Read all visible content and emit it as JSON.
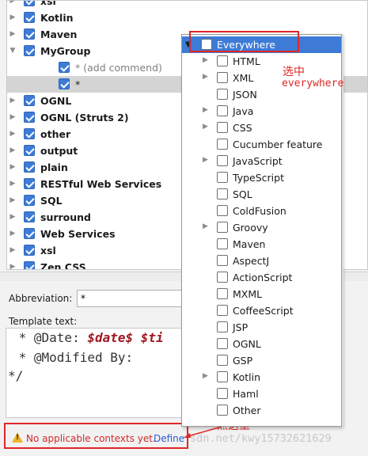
{
  "tree": {
    "items": [
      {
        "label": "xsl",
        "type": "group"
      },
      {
        "label": "Kotlin",
        "type": "group"
      },
      {
        "label": "Maven",
        "type": "group"
      },
      {
        "label": "MyGroup",
        "type": "group",
        "expanded": true
      },
      {
        "label": "* (add commend)",
        "type": "child"
      },
      {
        "label": "*",
        "type": "child",
        "selected": true
      },
      {
        "label": "OGNL",
        "type": "group"
      },
      {
        "label": "OGNL (Struts 2)",
        "type": "group"
      },
      {
        "label": "other",
        "type": "group"
      },
      {
        "label": "output",
        "type": "group"
      },
      {
        "label": "plain",
        "type": "group"
      },
      {
        "label": "RESTful Web Services",
        "type": "group"
      },
      {
        "label": "SQL",
        "type": "group"
      },
      {
        "label": "surround",
        "type": "group"
      },
      {
        "label": "Web Services",
        "type": "group"
      },
      {
        "label": "xsl",
        "type": "group"
      },
      {
        "label": "Zen CSS",
        "type": "group"
      }
    ]
  },
  "form": {
    "abbreviation_label": "Abbreviation:",
    "abbreviation_value": "*",
    "template_label": "Template text:"
  },
  "editor": {
    "line1_prefix": " * @Date: ",
    "line1_var": "$date$ $ti",
    "line2": " * @Modified By:",
    "line3": "*/"
  },
  "status": {
    "message": "No applicable contexts yet.",
    "link": "Define"
  },
  "popup": {
    "items": [
      {
        "label": "Everywhere",
        "expandable": true,
        "header": true
      },
      {
        "label": "HTML",
        "expandable": true
      },
      {
        "label": "XML",
        "expandable": true
      },
      {
        "label": "JSON",
        "expandable": false
      },
      {
        "label": "Java",
        "expandable": true
      },
      {
        "label": "CSS",
        "expandable": true
      },
      {
        "label": "Cucumber feature",
        "expandable": false
      },
      {
        "label": "JavaScript",
        "expandable": true
      },
      {
        "label": "TypeScript",
        "expandable": false
      },
      {
        "label": "SQL",
        "expandable": false
      },
      {
        "label": "ColdFusion",
        "expandable": false
      },
      {
        "label": "Groovy",
        "expandable": true
      },
      {
        "label": "Maven",
        "expandable": false
      },
      {
        "label": "AspectJ",
        "expandable": false
      },
      {
        "label": "ActionScript",
        "expandable": false
      },
      {
        "label": "MXML",
        "expandable": false
      },
      {
        "label": "CoffeeScript",
        "expandable": false
      },
      {
        "label": "JSP",
        "expandable": false
      },
      {
        "label": "OGNL",
        "expandable": false
      },
      {
        "label": "GSP",
        "expandable": false
      },
      {
        "label": "Kotlin",
        "expandable": true
      },
      {
        "label": "Haml",
        "expandable": false
      },
      {
        "label": "Other",
        "expandable": false
      }
    ]
  },
  "annotations": {
    "select_cn": "选中",
    "select_en": "everywhere",
    "click_here": "点这里"
  },
  "watermark": "sdn.net/kwy15732621629",
  "colors": {
    "accent": "#3d7bd6",
    "annotation_red": "#e02626",
    "link": "#2a5bd7"
  }
}
